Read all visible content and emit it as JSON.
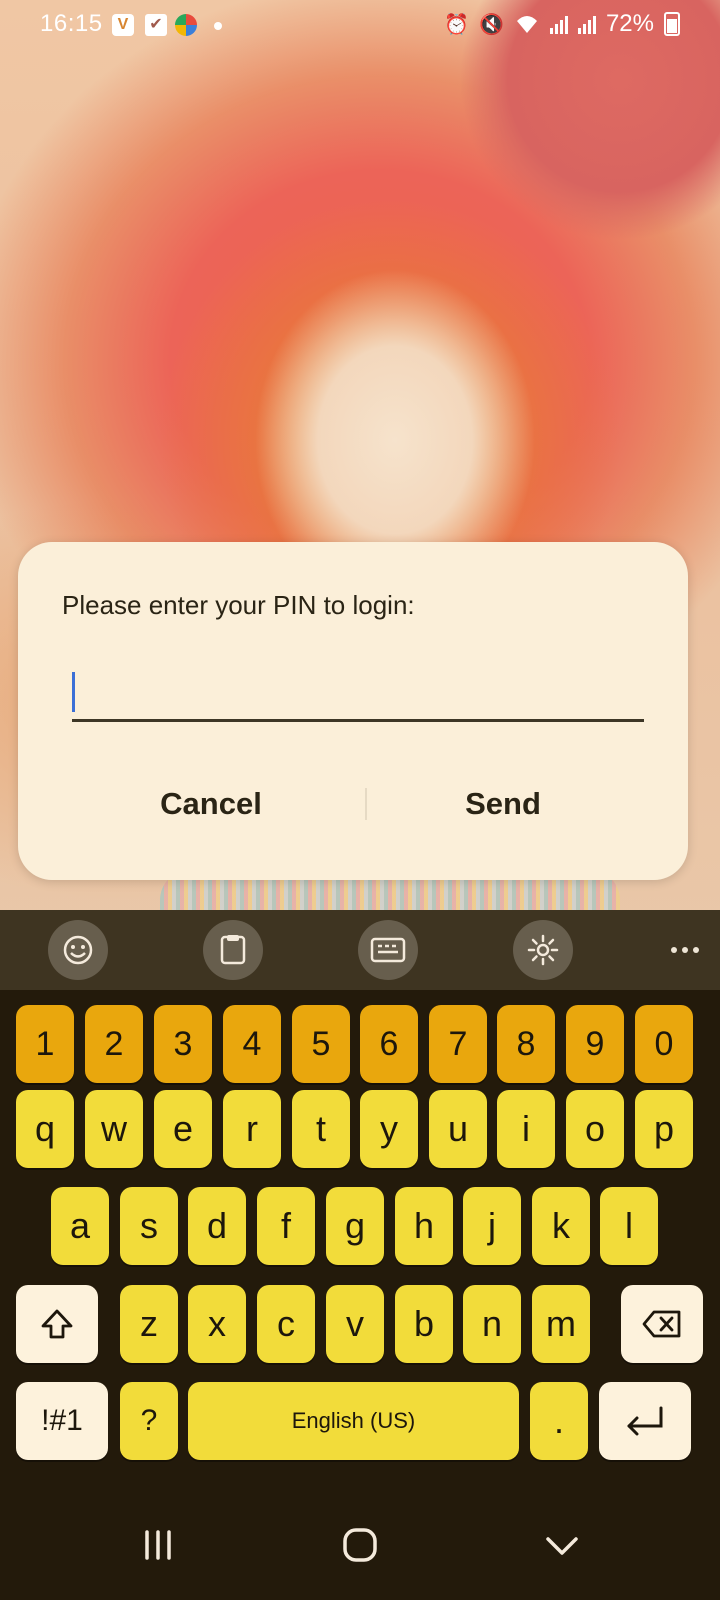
{
  "status_bar": {
    "time": "16:15",
    "battery": "72%",
    "notification_icons": [
      "v-app-icon",
      "check-icon",
      "browser-icon",
      "dot-icon"
    ],
    "system_icons": [
      "alarm-icon",
      "mute-icon",
      "wifi-icon",
      "signal-icon",
      "signal-icon",
      "battery-icon"
    ]
  },
  "dialog": {
    "message": "Please enter your PIN to login:",
    "input_value": "",
    "cancel_label": "Cancel",
    "send_label": "Send"
  },
  "keyboard": {
    "toolbar": [
      "emoji-icon",
      "clipboard-icon",
      "keyboard-mode-icon",
      "settings-icon",
      "more-icon"
    ],
    "number_row": [
      "1",
      "2",
      "3",
      "4",
      "5",
      "6",
      "7",
      "8",
      "9",
      "0"
    ],
    "row1": [
      "q",
      "w",
      "e",
      "r",
      "t",
      "y",
      "u",
      "i",
      "o",
      "p"
    ],
    "row2": [
      "a",
      "s",
      "d",
      "f",
      "g",
      "h",
      "j",
      "k",
      "l"
    ],
    "row3": [
      "z",
      "x",
      "c",
      "v",
      "b",
      "n",
      "m"
    ],
    "sym_label": "!#1",
    "question_label": "?",
    "space_label": "English (US)",
    "period_label": ".",
    "colors": {
      "number_key": "#e9a70d",
      "letter_key": "#f2dc3a",
      "function_key": "#fdf2dc",
      "background": "#231a0b"
    }
  },
  "navbar": [
    "recents-icon",
    "home-icon",
    "hide-keyboard-icon"
  ]
}
